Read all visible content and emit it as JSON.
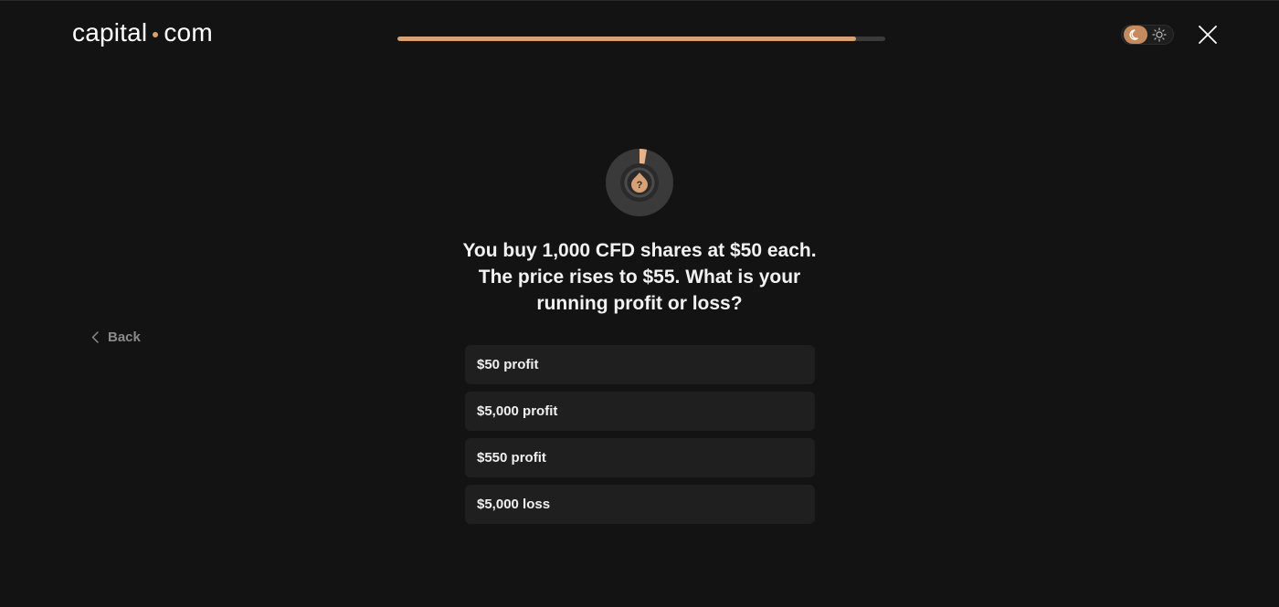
{
  "brand": {
    "logo_left": "capital",
    "logo_right": "com",
    "accent": "#d6a174"
  },
  "header": {
    "progress_fraction": 0.94,
    "theme_toggle": {
      "dark_icon": "moon-icon",
      "light_icon": "sun-icon",
      "active": "dark"
    },
    "close_icon": "close-icon"
  },
  "nav": {
    "back_label": "Back",
    "back_icon": "chevron-left-icon"
  },
  "quiz": {
    "icon": "question-timer-icon",
    "question": "You buy 1,000 CFD shares at $50 each. The price rises to $55. What is your running profit or loss?",
    "options": [
      "$50 profit",
      "$5,000 profit",
      "$550 profit",
      "$5,000 loss"
    ]
  }
}
